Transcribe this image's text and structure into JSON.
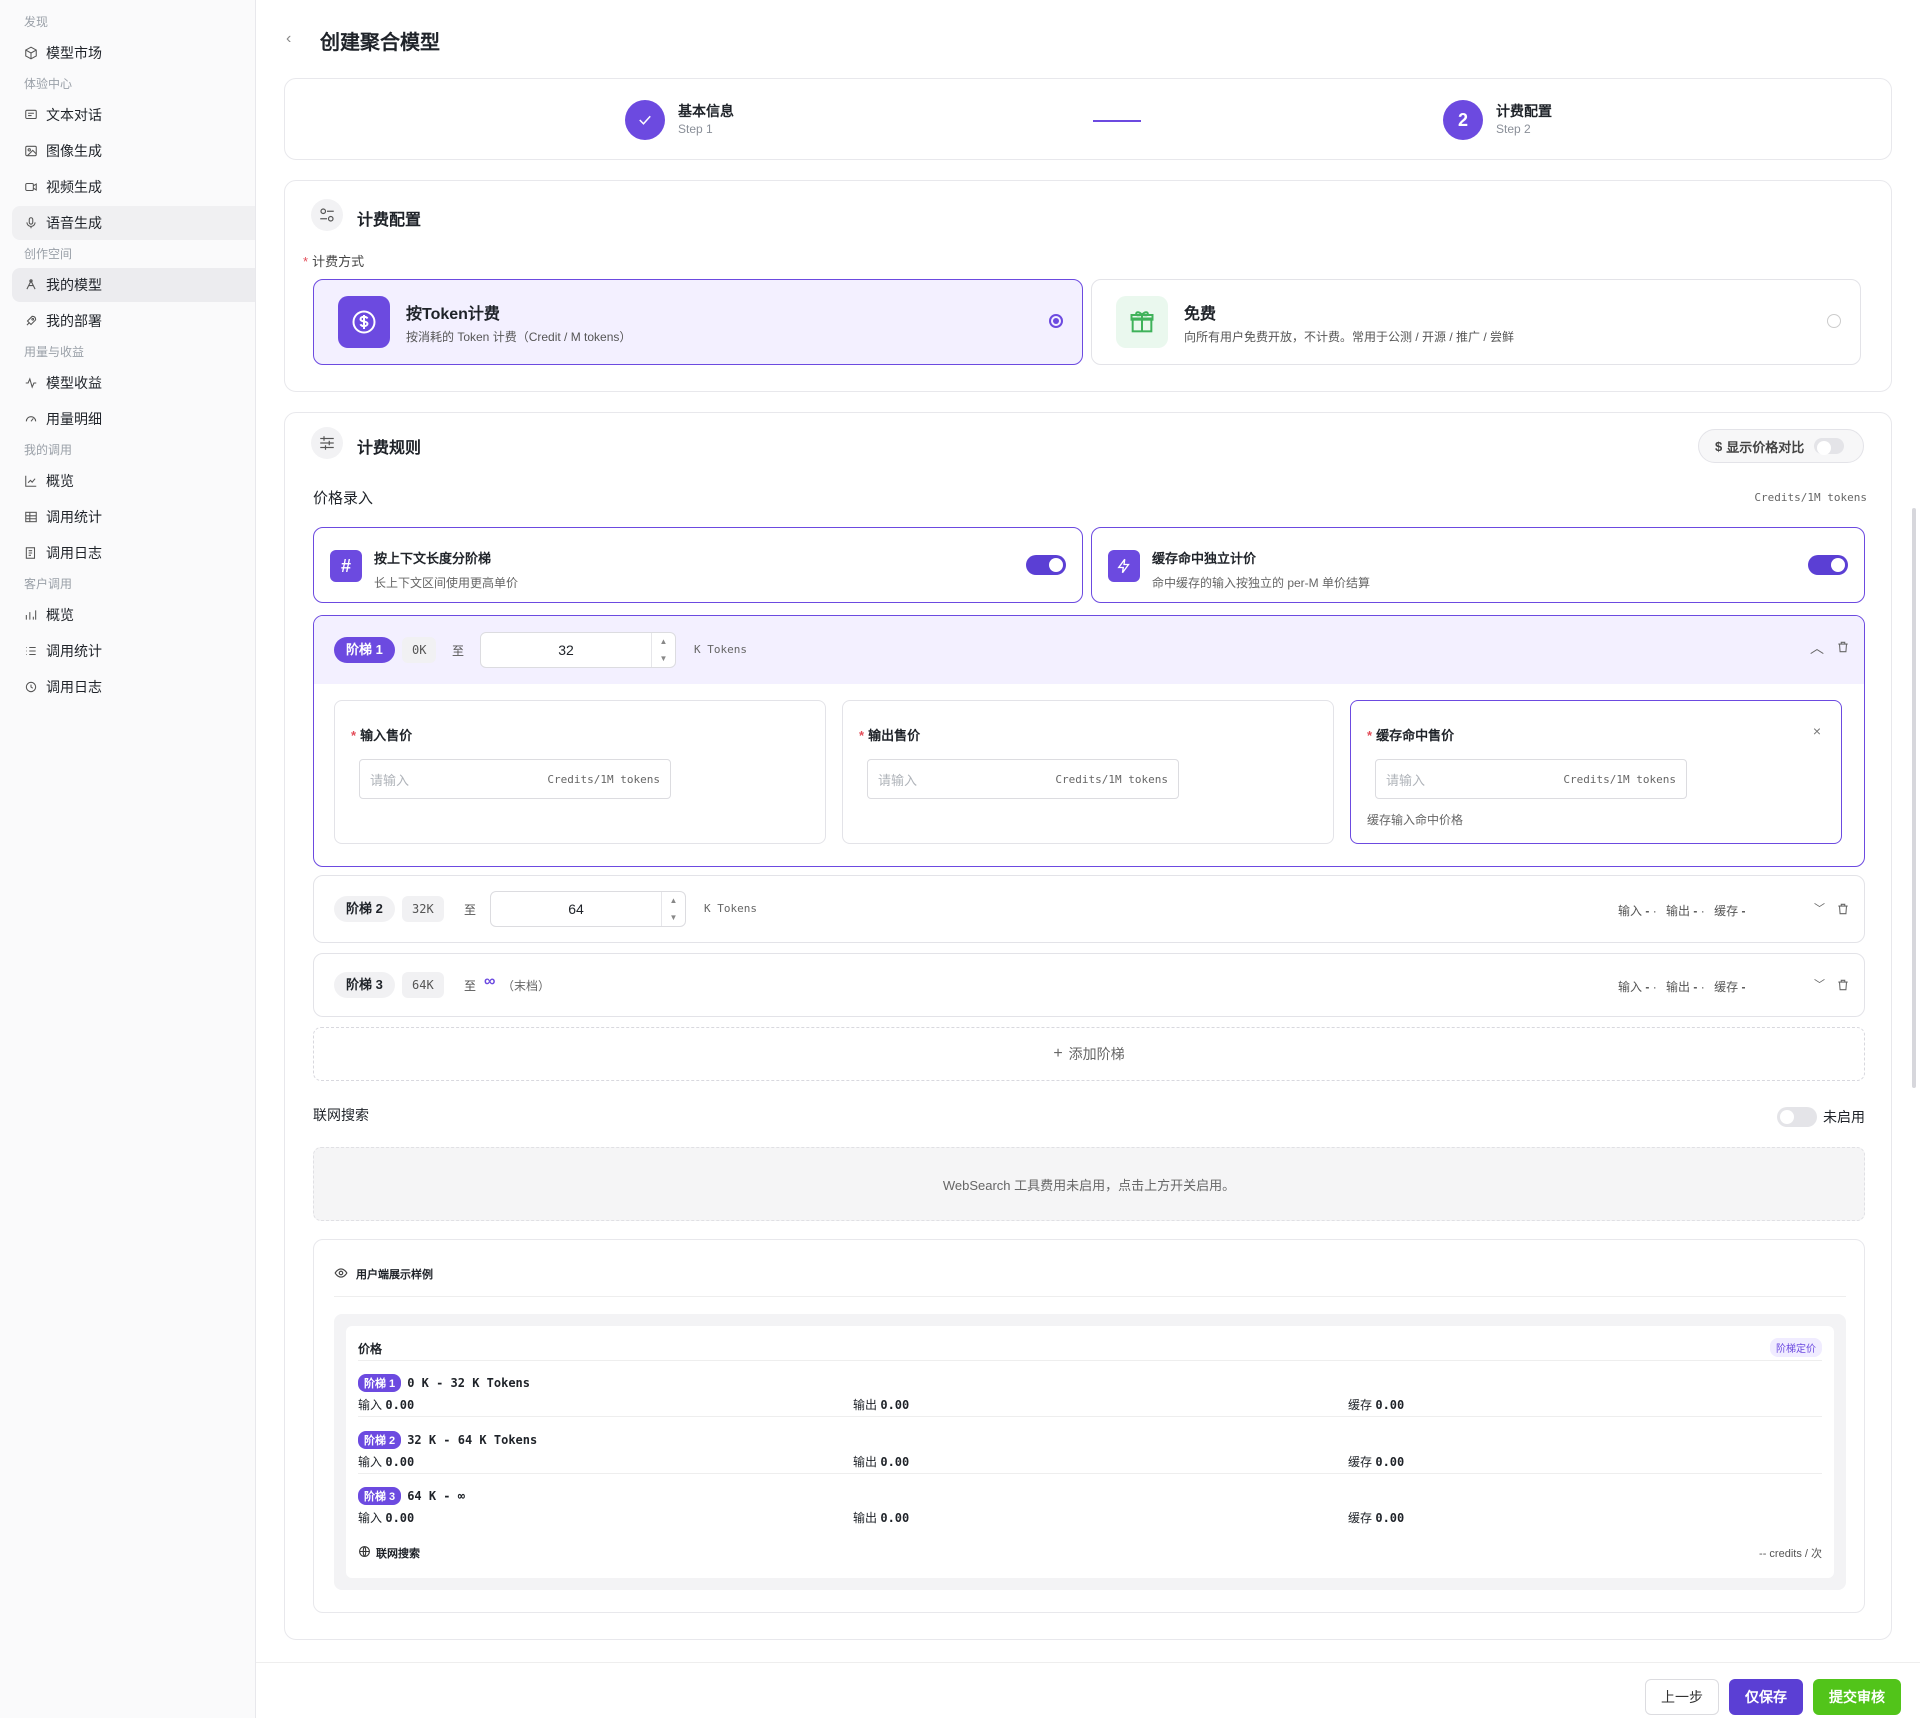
{
  "sidebar": {
    "groups": [
      {
        "label": "发现",
        "items": [
          {
            "label": "模型市场",
            "icon": "cube-icon"
          }
        ]
      },
      {
        "label": "体验中心",
        "items": [
          {
            "label": "文本对话",
            "icon": "chat-icon"
          },
          {
            "label": "图像生成",
            "icon": "image-icon"
          },
          {
            "label": "视频生成",
            "icon": "video-icon"
          },
          {
            "label": "语音生成",
            "icon": "mic-icon"
          }
        ]
      },
      {
        "label": "创作空间",
        "items": [
          {
            "label": "我的模型",
            "icon": "model-icon"
          },
          {
            "label": "我的部署",
            "icon": "rocket-icon"
          }
        ]
      },
      {
        "label": "用量与收益",
        "items": [
          {
            "label": "模型收益",
            "icon": "pulse-icon"
          },
          {
            "label": "用量明细",
            "icon": "gauge-icon"
          }
        ]
      },
      {
        "label": "我的调用",
        "items": [
          {
            "label": "概览",
            "icon": "chart-icon"
          },
          {
            "label": "调用统计",
            "icon": "table-icon"
          },
          {
            "label": "调用日志",
            "icon": "log-icon"
          }
        ]
      },
      {
        "label": "客户调用",
        "items": [
          {
            "label": "概览",
            "icon": "bars-icon"
          },
          {
            "label": "调用统计",
            "icon": "list-icon"
          },
          {
            "label": "调用日志",
            "icon": "clock-icon"
          }
        ]
      }
    ]
  },
  "header": {
    "title": "创建聚合模型"
  },
  "steps": [
    {
      "title": "基本信息",
      "sub": "Step 1",
      "done": true
    },
    {
      "title": "计费配置",
      "sub": "Step 2",
      "number": "2"
    }
  ],
  "billing": {
    "section_title": "计费配置",
    "method_label": "计费方式",
    "options": [
      {
        "title": "按Token计费",
        "desc": "按消耗的 Token 计费（Credit / M tokens）",
        "selected": true
      },
      {
        "title": "免费",
        "desc": "向所有用户免费开放，不计费。常用于公测 / 开源 / 推广 / 尝鲜",
        "selected": false
      }
    ]
  },
  "rules": {
    "section_title": "计费规则",
    "compare_label": "显示价格对比",
    "price_entry": "价格录入",
    "unit": "Credits/1M tokens",
    "features": [
      {
        "title": "按上下文长度分阶梯",
        "desc": "长上下文区间使用更高单价",
        "enabled": true
      },
      {
        "title": "缓存命中独立计价",
        "desc": "命中缓存的输入按独立的 per-M 单价结算",
        "enabled": true
      }
    ],
    "tiers": [
      {
        "label": "阶梯 1",
        "start": "0K",
        "to": "至",
        "end": "32",
        "unit": "K Tokens"
      },
      {
        "label": "阶梯 2",
        "start": "32K",
        "to": "至",
        "end": "64",
        "unit": "K Tokens"
      },
      {
        "label": "阶梯 3",
        "start": "64K",
        "to": "至",
        "end": "∞",
        "tail": "（末档）"
      }
    ],
    "price_fields": [
      {
        "label": "输入售价",
        "placeholder": "请输入",
        "unit": "Credits/1M tokens"
      },
      {
        "label": "输出售价",
        "placeholder": "请输入",
        "unit": "Credits/1M tokens"
      },
      {
        "label": "缓存命中售价",
        "placeholder": "请输入",
        "unit": "Credits/1M tokens",
        "hint": "缓存输入命中价格"
      }
    ],
    "summary": {
      "in": "输入",
      "out": "输出",
      "cache": "缓存",
      "dash": "-",
      "dot": "·"
    },
    "add_tier": "添加阶梯"
  },
  "websearch": {
    "label": "联网搜索",
    "state": "未启用",
    "empty": "WebSearch 工具费用未启用，点击上方开关启用。"
  },
  "preview": {
    "title": "用户端展示样例",
    "price_label": "价格",
    "badge": "阶梯定价",
    "rows": [
      {
        "tier": "阶梯 1",
        "range": "0 K - 32 K Tokens",
        "in": "0.00",
        "out": "0.00",
        "cache": "0.00"
      },
      {
        "tier": "阶梯 2",
        "range": "32 K - 64 K Tokens",
        "in": "0.00",
        "out": "0.00",
        "cache": "0.00"
      },
      {
        "tier": "阶梯 3",
        "range": "64 K - ∞",
        "in": "0.00",
        "out": "0.00",
        "cache": "0.00"
      }
    ],
    "labels": {
      "in": "输入",
      "out": "输出",
      "cache": "缓存"
    },
    "websearch": "联网搜索",
    "websearch_value": "-- credits / 次"
  },
  "footer": {
    "prev": "上一步",
    "save": "仅保存",
    "submit": "提交审核"
  },
  "colors": {
    "accent": "#6c4ae0",
    "submit": "#52c41a"
  }
}
